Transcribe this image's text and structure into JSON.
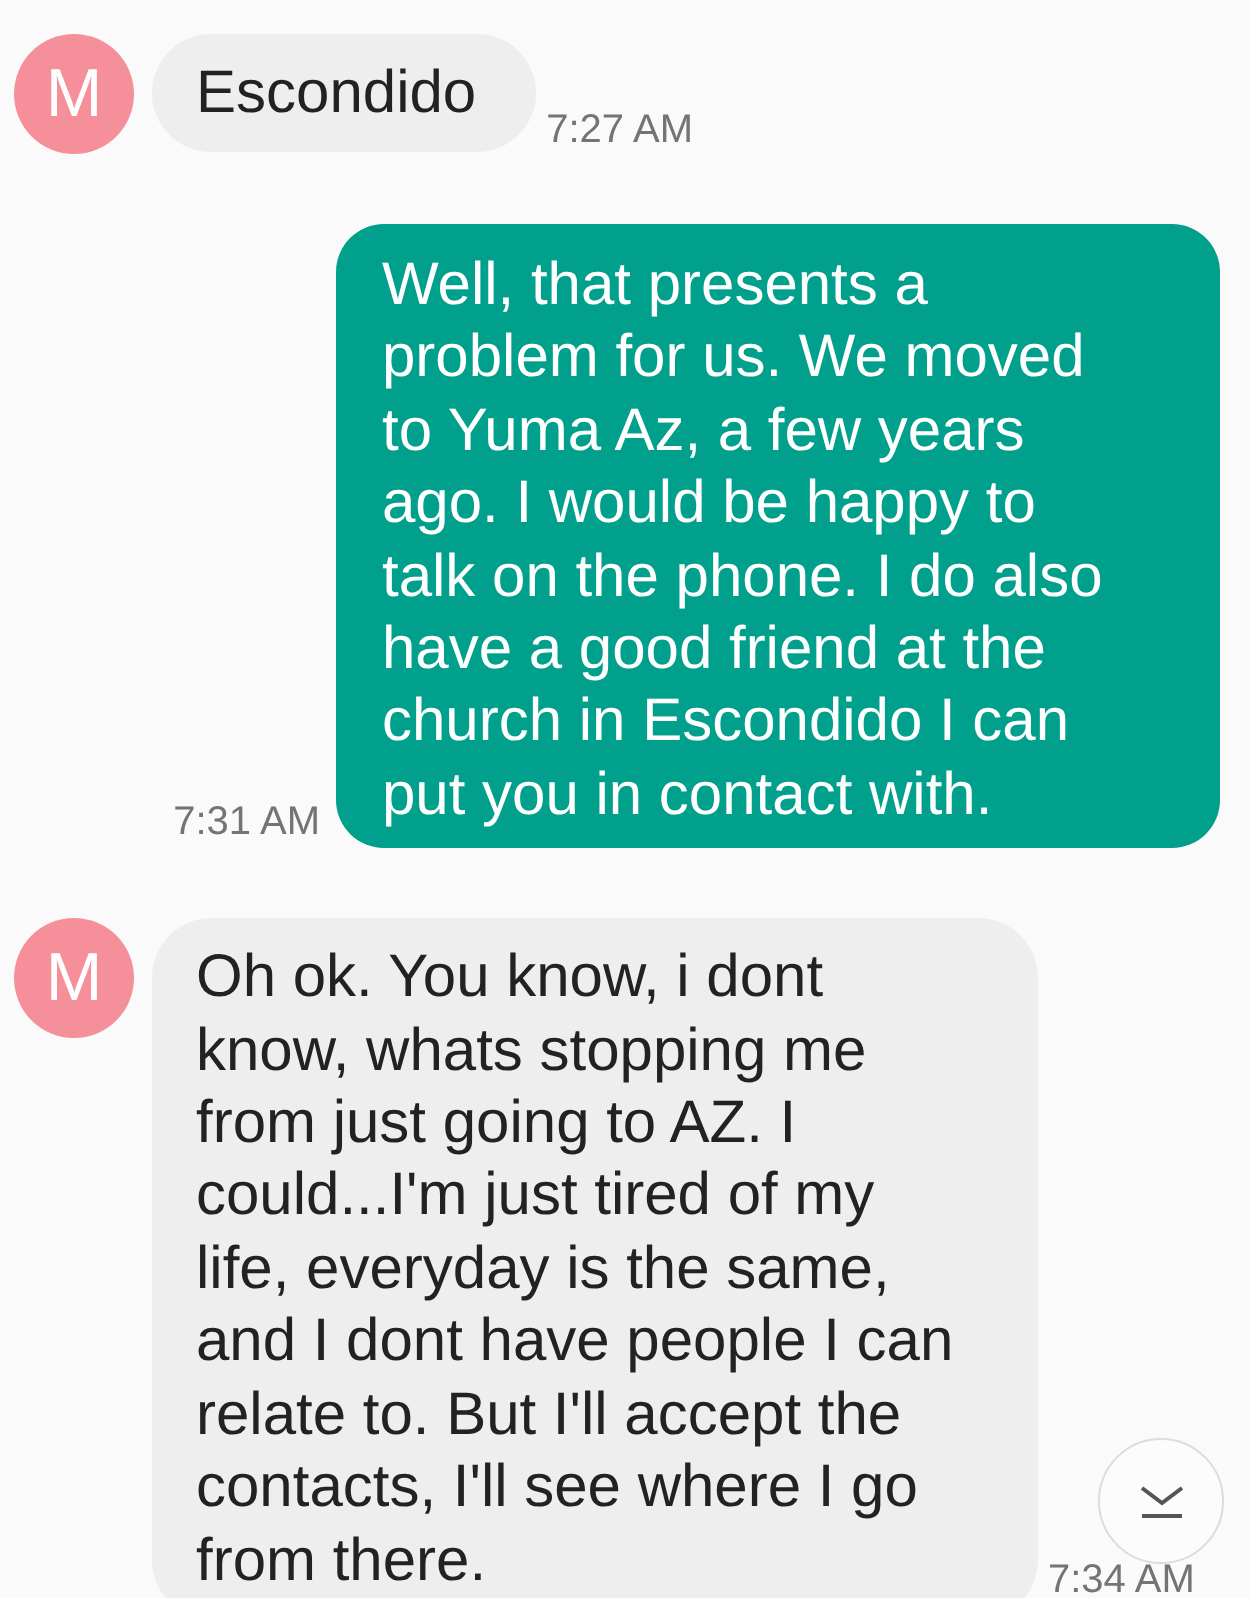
{
  "messages": [
    {
      "kind": "incoming",
      "avatar": "M",
      "text": "Escondido",
      "time": "7:27 AM"
    },
    {
      "kind": "outgoing",
      "text": "Well, that presents a\nproblem for us. We moved to Yuma Az, a few years ago. I would be happy to talk on the phone. I do also have a good friend at the church in Escondido I can put you in contact with.",
      "time": "7:31 AM"
    },
    {
      "kind": "incoming",
      "avatar": "M",
      "text": "Oh ok. You know, i dont know, whats stopping me from just going to AZ. I could...I'm just tired of my life, everyday is the same, and I dont have people I can relate to. But I'll accept the contacts, I'll see where I go from there.",
      "time": "7:34 AM"
    }
  ]
}
